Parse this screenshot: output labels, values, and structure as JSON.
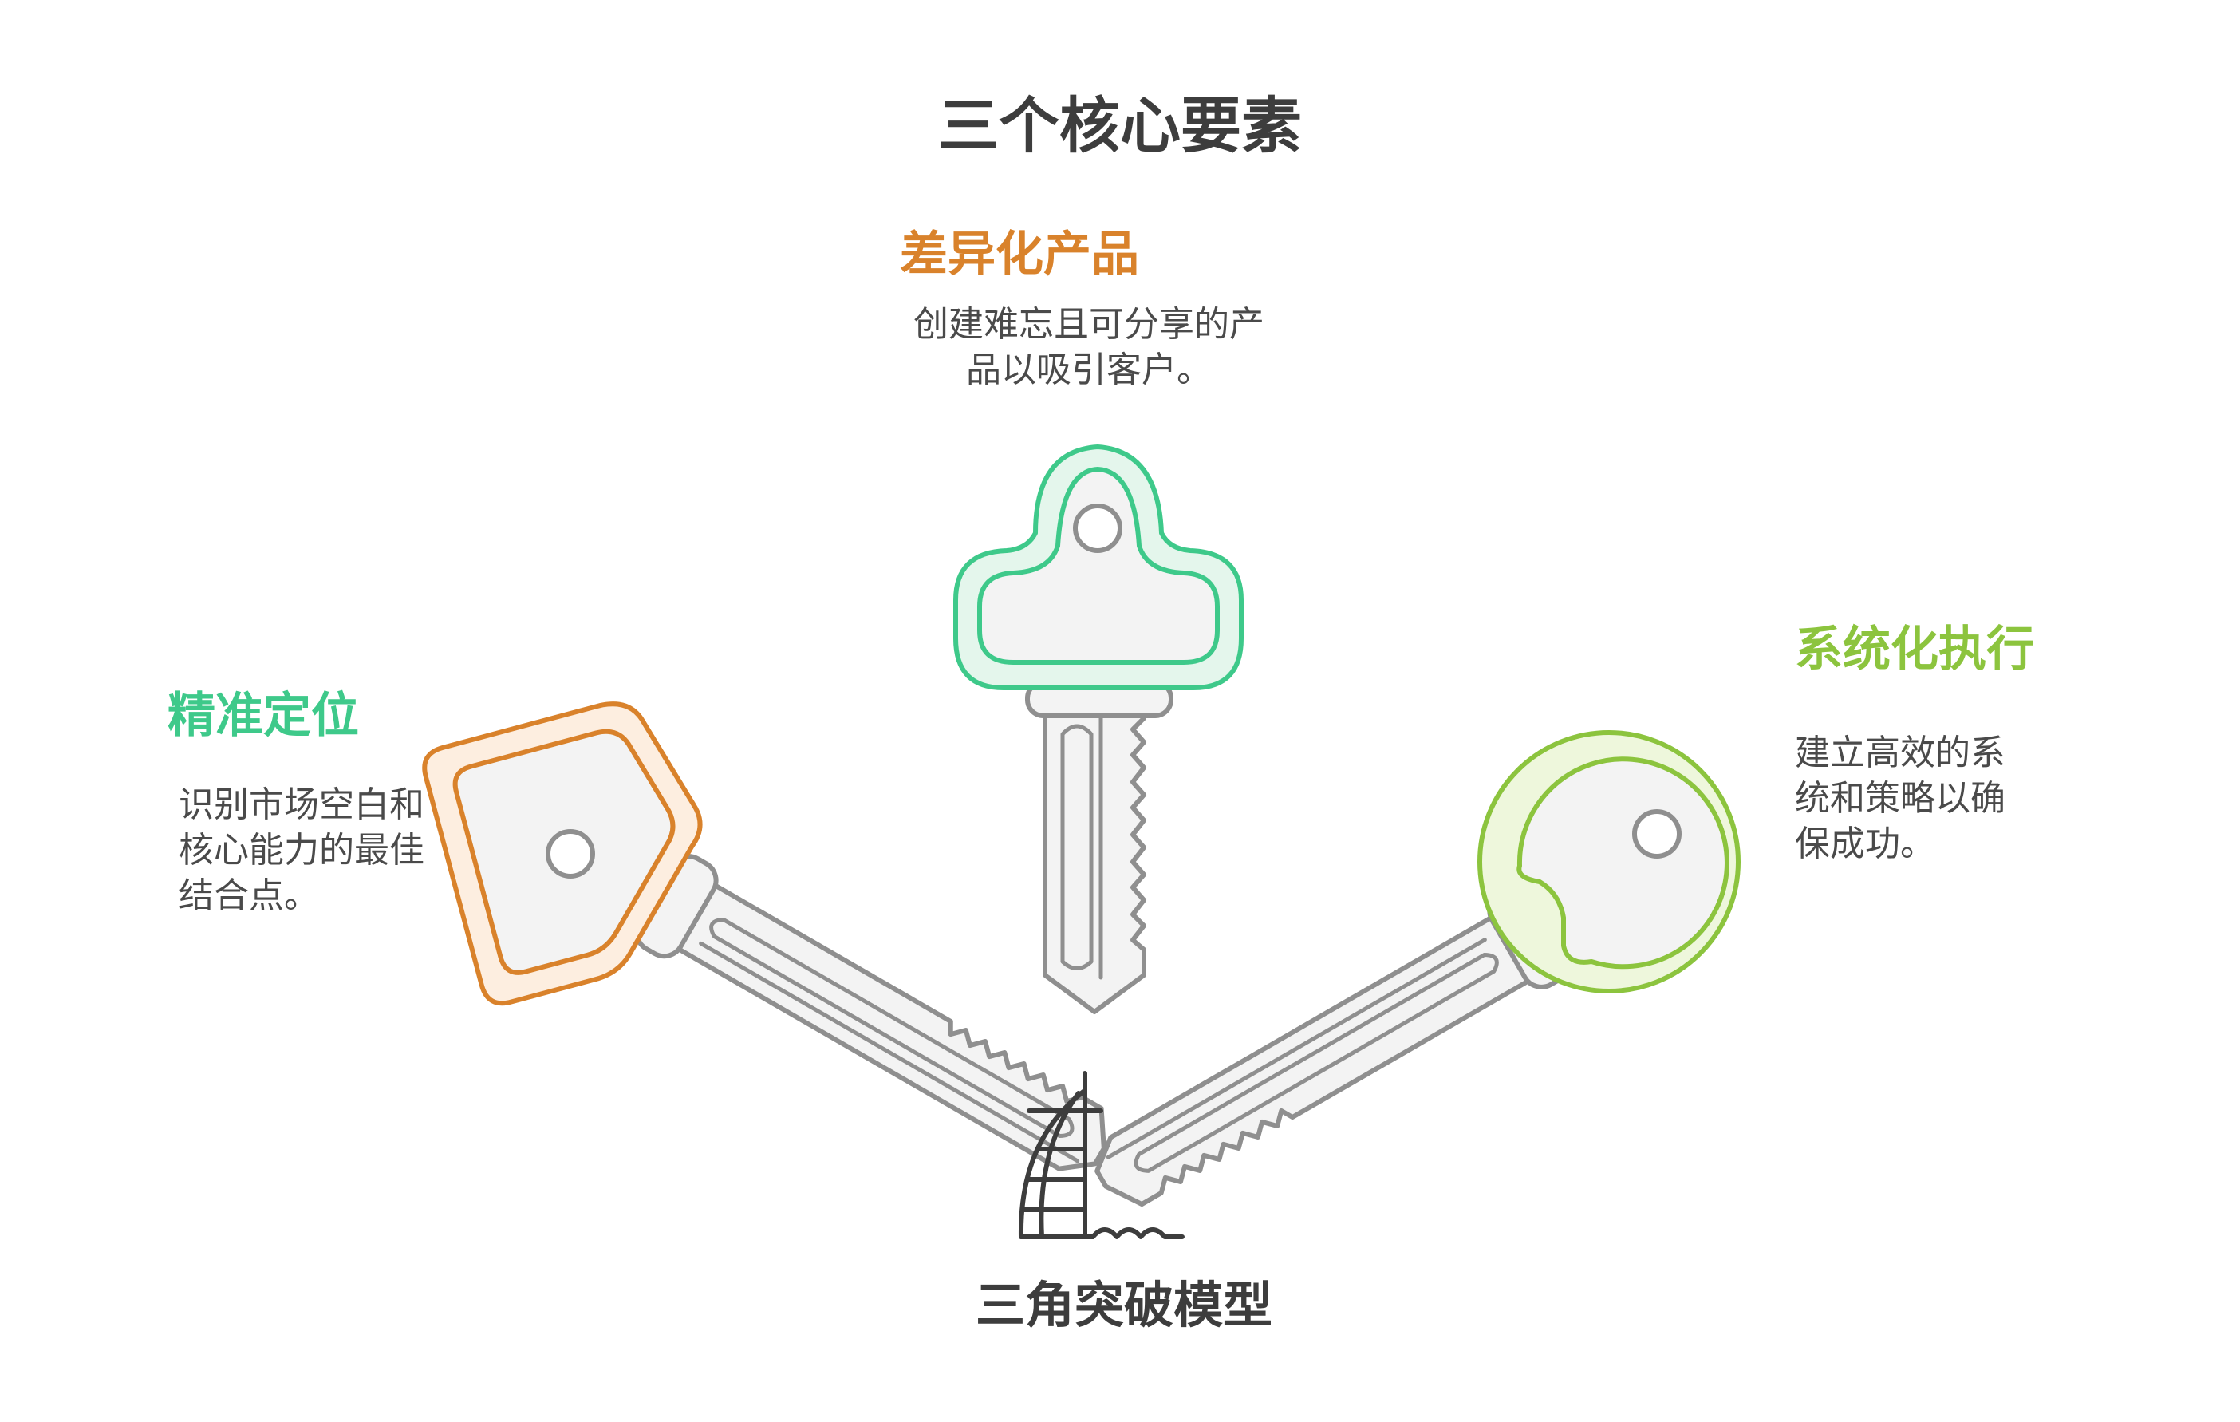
{
  "title": "三个核心要素",
  "bottom_label": "三角突破模型",
  "colors": {
    "orange": "#d9822b",
    "green": "#3ec98a",
    "lime": "#8cc43e",
    "gray": "#8f8f8f",
    "key_fill": "#f3f3f3",
    "text_dark": "#3d3d3d"
  },
  "elements": {
    "product": {
      "heading": "差异化产品",
      "desc_line1": "创建难忘且可分享的产",
      "desc_line2": "品以吸引客户。",
      "heading_color": "#d9822b",
      "key_color": "#3ec98a"
    },
    "positioning": {
      "heading": "精准定位",
      "desc_line1": "识别市场空白和",
      "desc_line2": "核心能力的最佳",
      "desc_line3": "结合点。",
      "heading_color": "#3ec98a",
      "key_color": "#d9822b"
    },
    "execution": {
      "heading": "系统化执行",
      "desc_line1": "建立高效的系",
      "desc_line2": "统和策略以确",
      "desc_line3": "保成功。",
      "heading_color": "#8cc43e",
      "key_color": "#8cc43e"
    }
  },
  "icons": {
    "center": "sail-hotel-icon",
    "left_key": "square-key-icon",
    "top_key": "cloud-key-icon",
    "right_key": "round-key-icon"
  }
}
